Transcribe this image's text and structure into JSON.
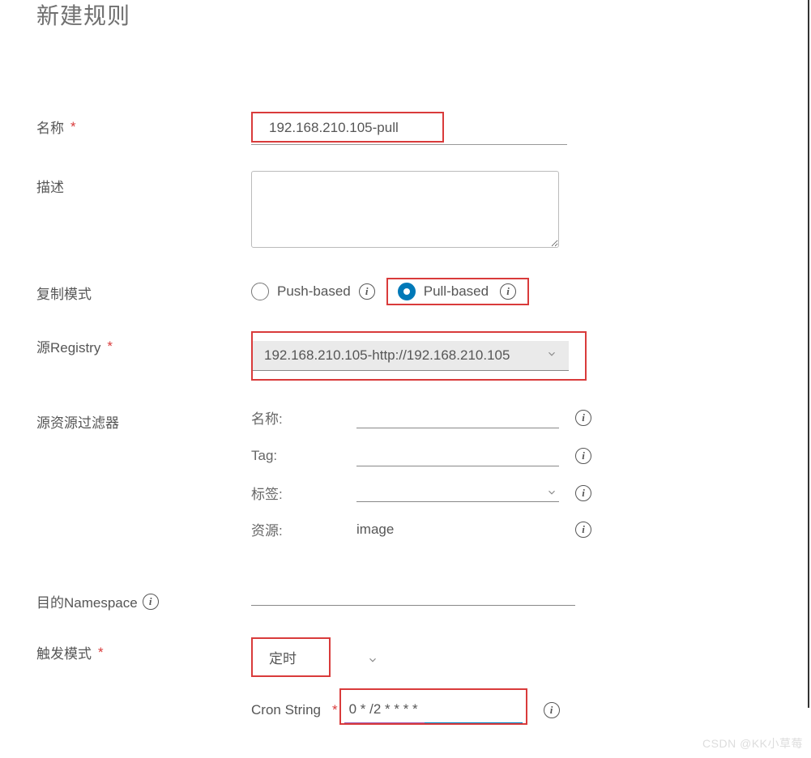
{
  "dialog": {
    "title": "新建规则"
  },
  "form": {
    "name_label": "名称",
    "name_value": "192.168.210.105-pull",
    "desc_label": "描述",
    "mode_label": "复制模式",
    "mode_push": "Push-based",
    "mode_pull": "Pull-based",
    "src_registry_label": "源Registry",
    "src_registry_value": "192.168.210.105-http://192.168.210.105",
    "filter_label": "源资源过滤器",
    "filter": {
      "name_label": "名称:",
      "tag_label": "Tag:",
      "labels_label": "标签:",
      "resource_label": "资源:",
      "resource_value": "image"
    },
    "dest_ns_label": "目的Namespace",
    "trigger_label": "触发模式",
    "trigger_value": "定时",
    "cron_label": "Cron String",
    "cron_value": "0 * /2 * * * *"
  },
  "watermark": "CSDN @KK小草莓"
}
